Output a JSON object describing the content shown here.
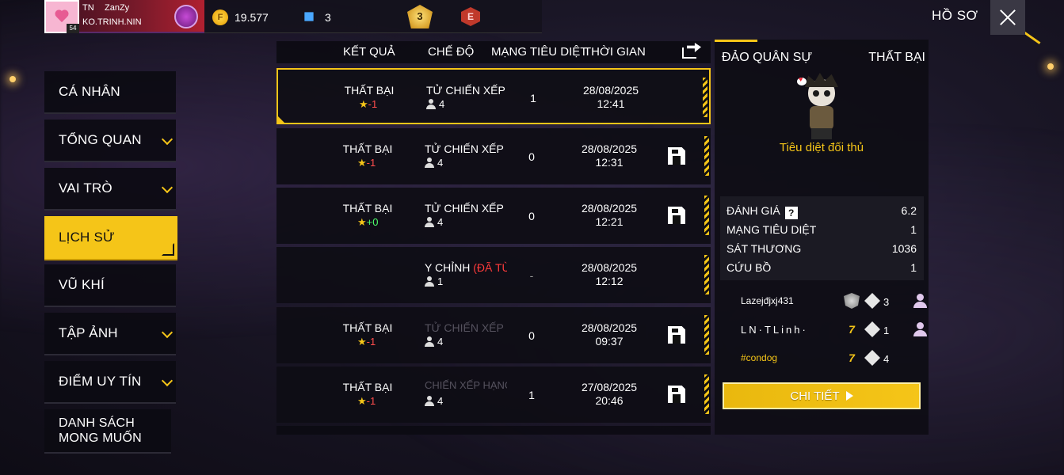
{
  "header": {
    "guild_tag": "TN",
    "player_name": "ZanZy",
    "player_sign": "KO.TRINH.NIN",
    "level": "54",
    "gold": "19.577",
    "diamonds": "3",
    "rank_badge": "3",
    "elite_badge": "E",
    "screen_title": "HỒ SƠ"
  },
  "sidebar": {
    "items": [
      {
        "label": "CÁ NHÂN",
        "expandable": false,
        "active": false
      },
      {
        "label": "TỔNG QUAN",
        "expandable": true,
        "active": false
      },
      {
        "label": "VAI TRÒ",
        "expandable": true,
        "active": false
      },
      {
        "label": "LỊCH SỬ",
        "expandable": false,
        "active": true
      },
      {
        "label": "VŨ KHÍ",
        "expandable": false,
        "active": false
      },
      {
        "label": "TẬP ẢNH",
        "expandable": true,
        "active": false
      },
      {
        "label": "ĐIỂM UY TÍN",
        "expandable": true,
        "active": false
      },
      {
        "label": "DANH SÁCH MONG MUỐN",
        "expandable": false,
        "active": false
      }
    ]
  },
  "history": {
    "columns": [
      "KẾT QUẢ",
      "CHẾ ĐỘ",
      "MẠNG TIÊU DIỆT",
      "THỜI GIAN"
    ],
    "rows": [
      {
        "result": "THẤT BẠI",
        "star": "★",
        "delta": "-1",
        "mode": "TỬ CHIẾN XẾP HẠ",
        "mode_suffix": "",
        "players": "4",
        "kills": "1",
        "date": "28/08/2025",
        "time": "12:41",
        "selected": true
      },
      {
        "result": "THẤT BẠI",
        "star": "★",
        "delta": "-1",
        "mode": "TỬ CHIẾN XẾP HẠ",
        "mode_suffix": "",
        "players": "4",
        "kills": "0",
        "date": "28/08/2025",
        "time": "12:31"
      },
      {
        "result": "THẤT BẠI",
        "star": "★",
        "delta": "+0",
        "mode": "TỬ CHIẾN XẾP HẠ",
        "mode_suffix": "",
        "players": "4",
        "kills": "0",
        "date": "28/08/2025",
        "time": "12:21"
      },
      {
        "result": "",
        "star": "",
        "delta": "",
        "mode": "Y CHỈNH ",
        "mode_suffix": "(ĐÃ TỪ B",
        "players": "1",
        "kills": "-",
        "date": "28/08/2025",
        "time": "12:12"
      },
      {
        "result": "THẤT BẠI",
        "star": "★",
        "delta": "-1",
        "mode": "TỬ CHIẾN XẾP HẠ",
        "mode_suffix": "",
        "players": "4",
        "kills": "0",
        "date": "28/08/2025",
        "time": "09:37"
      },
      {
        "result": "THẤT BẠI",
        "star": "★",
        "delta": "-1",
        "mode": "CHIẾN XẾP HẠNG",
        "mode_suffix": "",
        "players": "4",
        "kills": "1",
        "date": "27/08/2025",
        "time": "20:46"
      }
    ]
  },
  "detail": {
    "map": "ĐẢO QUÂN SỰ",
    "result": "THẤT BẠI",
    "mascot_caption": "Tiêu diệt đối thủ",
    "stats": [
      {
        "label": "ĐÁNH GIÁ",
        "value": "6.2",
        "help": "?"
      },
      {
        "label": "MẠNG TIÊU DIỆT",
        "value": "1"
      },
      {
        "label": "SÁT THƯƠNG",
        "value": "1036"
      },
      {
        "label": "CỨU BỒ",
        "value": "1"
      }
    ],
    "team": [
      {
        "name": "Lazejđjxj431",
        "kills": "3",
        "rank_icon": "shield-icon",
        "style": "plain"
      },
      {
        "name": "LN·TLinh·",
        "kills": "1",
        "rank_icon": "ff-icon",
        "style": "spaced"
      },
      {
        "name": "#condog",
        "kills": "4",
        "rank_icon": "ff-icon",
        "style": "gold"
      }
    ],
    "rank_ff_glyph": "7",
    "button_label": "CHI TIẾT"
  },
  "colors": {
    "accent": "#f5c518",
    "loss_delta": "#ff4d4d",
    "gain_delta": "#4dff6a",
    "panel": "#0e0d14"
  }
}
